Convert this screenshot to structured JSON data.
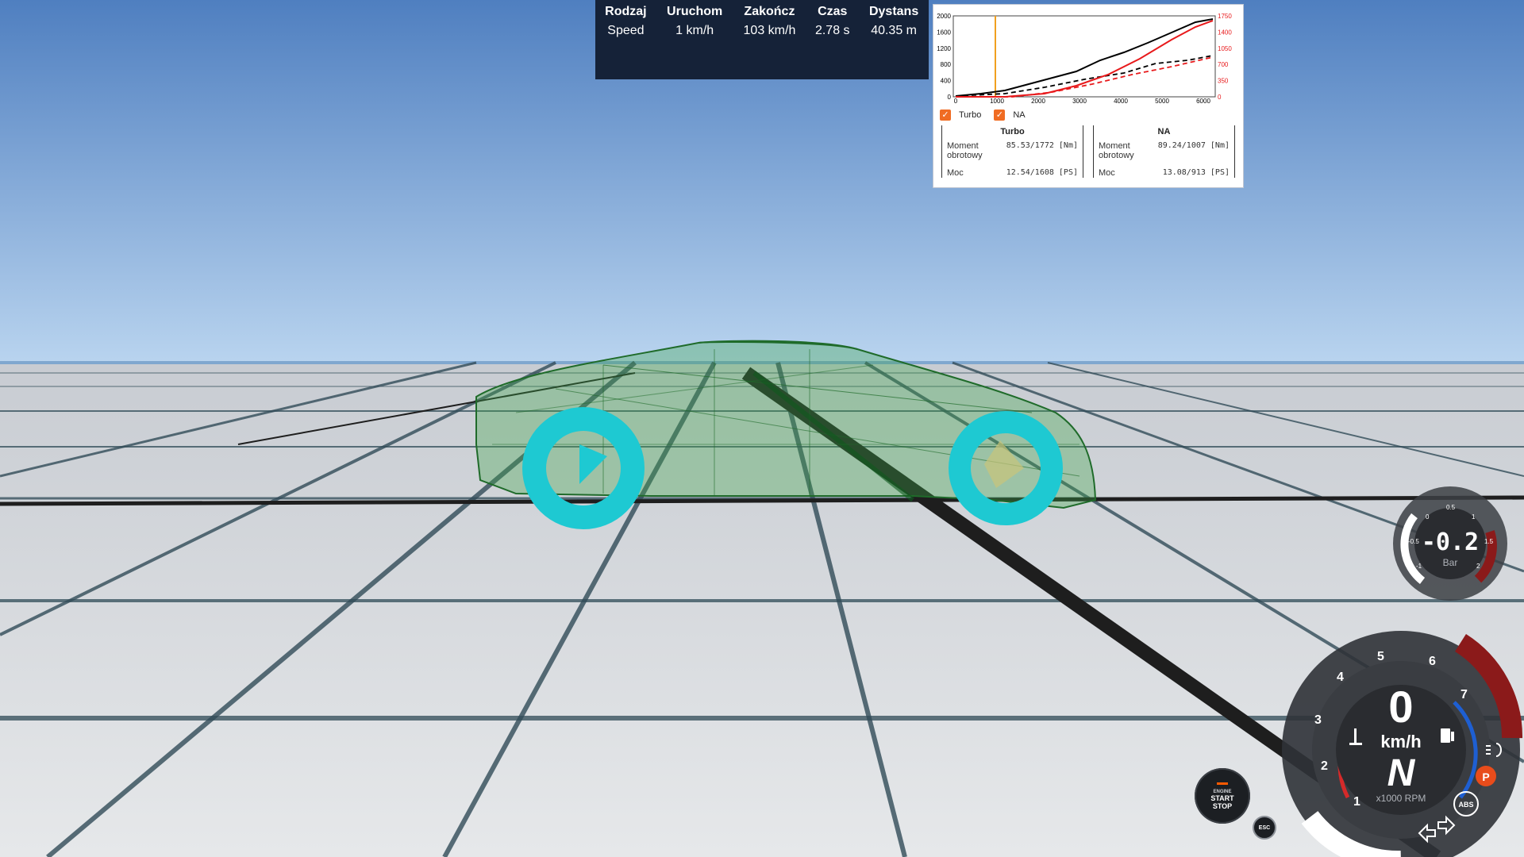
{
  "results": {
    "headers": [
      "Rodzaj",
      "Uruchom",
      "Zakończ",
      "Czas",
      "Dystans"
    ],
    "row": [
      "Speed",
      "1 km/h",
      "103 km/h",
      "2.78 s",
      "40.35 m"
    ]
  },
  "dyno": {
    "y_left_ticks": [
      "0",
      "400",
      "800",
      "1200",
      "1600",
      "2000"
    ],
    "y_right_ticks": [
      "0",
      "350",
      "700",
      "1050",
      "1400",
      "1750"
    ],
    "x_ticks": [
      "0",
      "1000",
      "2000",
      "3000",
      "4000",
      "5000",
      "6000"
    ],
    "legend": [
      {
        "label": "Turbo",
        "checked": true
      },
      {
        "label": "NA",
        "checked": true
      }
    ],
    "stats": {
      "turbo": {
        "title": "Turbo",
        "torque_label": "Moment obrotowy",
        "torque_value": "85.53/1772 [Nm]",
        "power_label": "Moc",
        "power_value": "12.54/1608 [PS]"
      },
      "na": {
        "title": "NA",
        "torque_label": "Moment obrotowy",
        "torque_value": "89.24/1007 [Nm]",
        "power_label": "Moc",
        "power_value": "13.08/913  [PS]"
      }
    },
    "colors": {
      "turbo": "#000000",
      "na": "#e8191b",
      "marker": "#f0a020"
    }
  },
  "boost_gauge": {
    "value": "-0.2",
    "unit": "Bar",
    "ticks": [
      "-1",
      "-0.5",
      "0",
      "0.5",
      "1",
      "1.5",
      "2"
    ]
  },
  "speedometer": {
    "speed": "0",
    "unit": "km/h",
    "gear": "N",
    "rpm_label": "x1000 RPM",
    "rpm_ticks": [
      "1",
      "2",
      "3",
      "4",
      "5",
      "6",
      "7"
    ]
  },
  "buttons": {
    "engine_top": "ENGINE",
    "engine_mid": "START",
    "engine_bot": "STOP",
    "esc": "ESC",
    "abs": "ABS",
    "park": "P"
  }
}
